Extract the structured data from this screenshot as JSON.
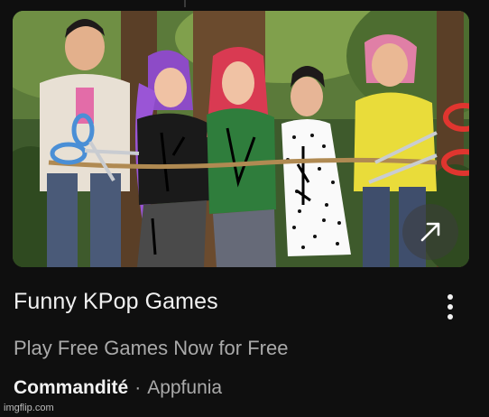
{
  "ad": {
    "title": "Funny KPop Games",
    "subtitle": "Play Free Games Now for Free",
    "sponsor_label": "Commandité",
    "separator": "·",
    "advertiser": "Appfunia"
  },
  "thumbnail": {
    "icon": "external-link-arrow-icon",
    "menu_icon": "more-vertical-icon"
  },
  "watermark": "imgflip.com",
  "colors": {
    "background": "#0f0f0f",
    "title": "#f1f1f1",
    "secondary_text": "#aaaaaa",
    "scissors_blue": "#4a8fd6",
    "scissors_red": "#e0352f"
  }
}
